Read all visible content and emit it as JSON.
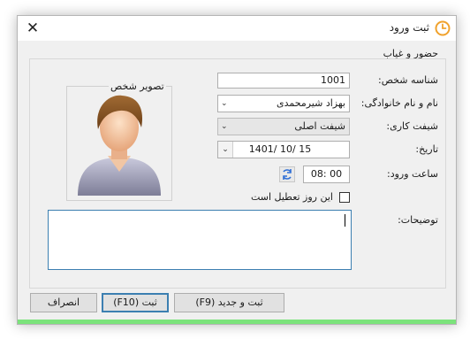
{
  "window": {
    "title": "ثبت ورود",
    "group_title": "حضور و غیاب"
  },
  "photo": {
    "caption": "تصویر شخص"
  },
  "form": {
    "person_id_label": "شناسه شخص:",
    "person_id_value": "1001",
    "name_label": "نام و نام خانوادگی:",
    "name_value": "بهزاد شیرمحمدی",
    "shift_label": "شیفت کاری:",
    "shift_value": "شیفت اصلی",
    "date_label": "تاریخ:",
    "date_value": "1401/ 10/ 15",
    "time_label": "ساعت ورود:",
    "time_value": "08: 00",
    "holiday_label": "این روز تعطیل است",
    "holiday_checked": false,
    "notes_label": "توضیحات:",
    "notes_value": ""
  },
  "buttons": {
    "save_new": "ثبت و جدید (F9)",
    "save": "ثبت (F10)",
    "cancel": "انصراف"
  },
  "colors": {
    "accent": "#3c7fb1",
    "status_strip": "#7be37b"
  }
}
